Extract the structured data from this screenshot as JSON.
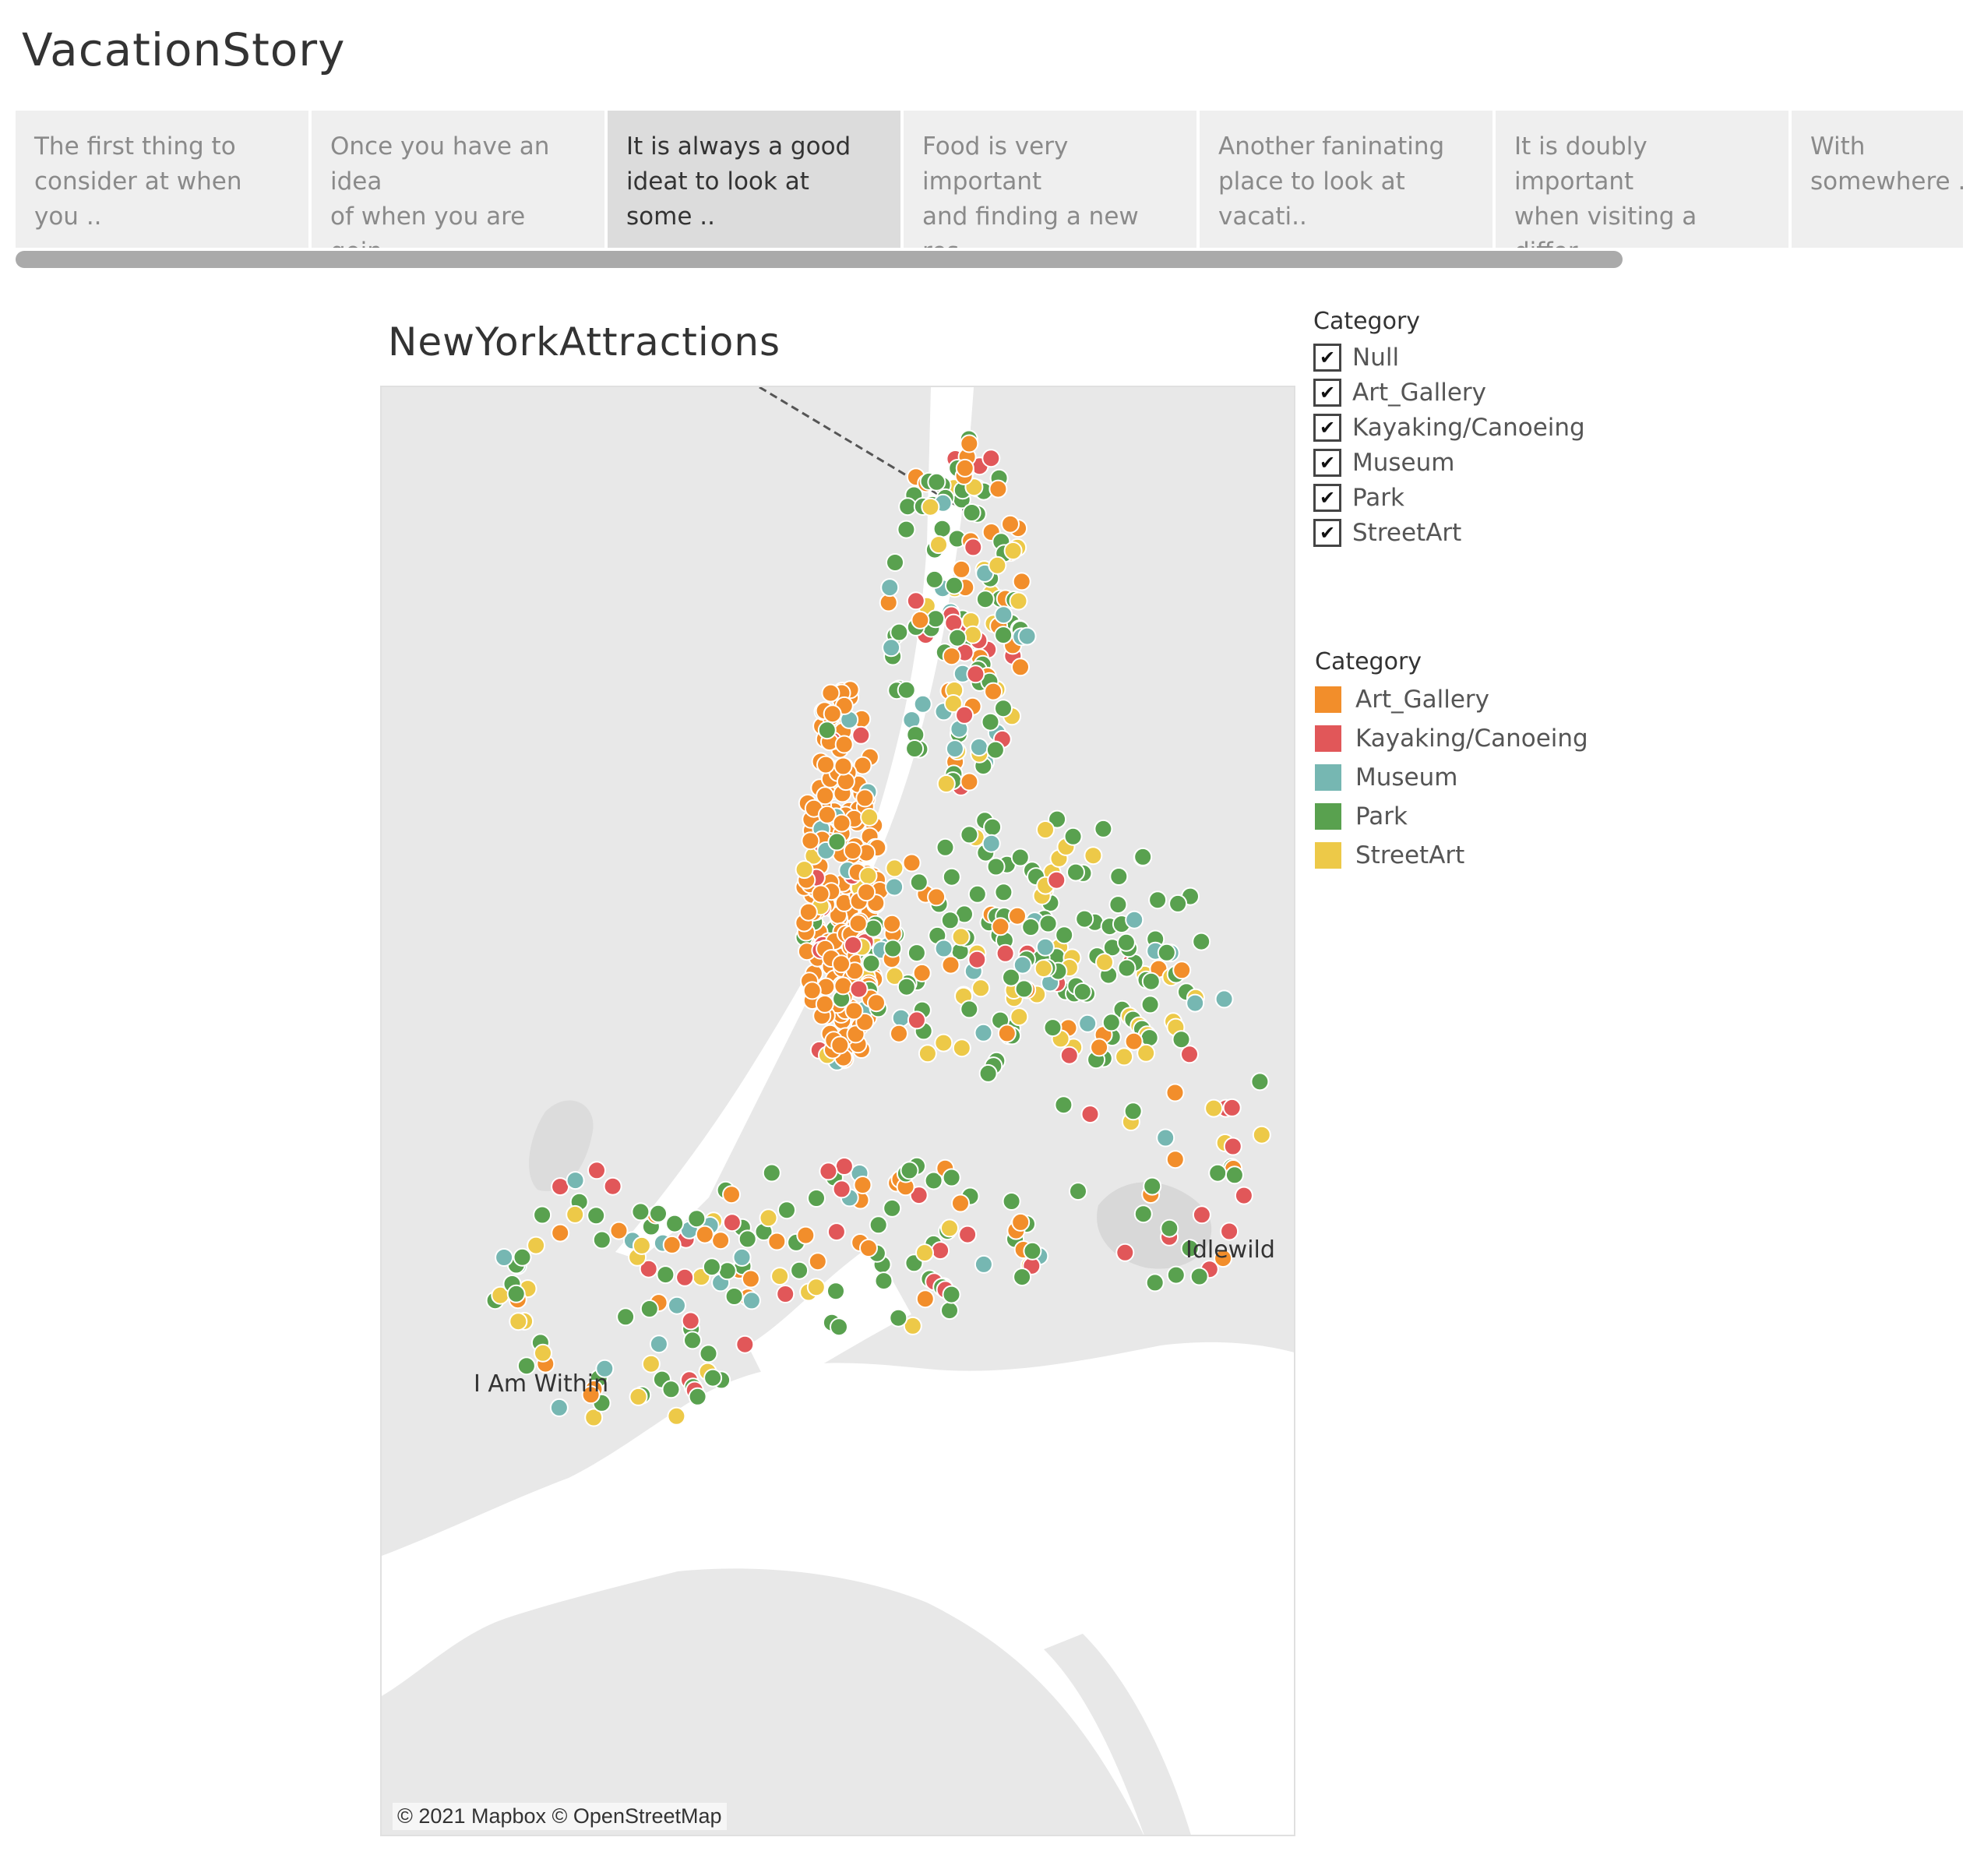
{
  "story": {
    "title": "VacationStory"
  },
  "tabs": [
    {
      "text": "The first thing to\nconsider at when you ..",
      "active": false
    },
    {
      "text": "Once you have an idea\nof when you are goin..",
      "active": false
    },
    {
      "text": "It is always a good\nideat to look at some ..",
      "active": true
    },
    {
      "text": "Food is very important\nand finding a new res..",
      "active": false
    },
    {
      "text": "Another faninating\nplace to look at vacati..",
      "active": false
    },
    {
      "text": "It is doubly important\nwhen visiting a differ..",
      "active": false
    },
    {
      "text": "With\nsomewhere ..",
      "active": false
    }
  ],
  "map": {
    "title": "NewYorkAttractions",
    "labels": {
      "idlewild": "Idlewild",
      "i_am_within": "I Am Within"
    },
    "attribution": "© 2021 Mapbox © OpenStreetMap"
  },
  "filter": {
    "title": "Category",
    "items": [
      {
        "label": "Null",
        "checked": true
      },
      {
        "label": "Art_Gallery",
        "checked": true
      },
      {
        "label": "Kayaking/Canoeing",
        "checked": true
      },
      {
        "label": "Museum",
        "checked": true
      },
      {
        "label": "Park",
        "checked": true
      },
      {
        "label": "StreetArt",
        "checked": true
      }
    ],
    "check_glyph": "✔"
  },
  "legend": {
    "title": "Category",
    "items": [
      {
        "label": "Art_Gallery",
        "color": "#f28e2b"
      },
      {
        "label": "Kayaking/Canoeing",
        "color": "#e15759"
      },
      {
        "label": "Museum",
        "color": "#76b7b2"
      },
      {
        "label": "Park",
        "color": "#59a14f"
      },
      {
        "label": "StreetArt",
        "color": "#edc948"
      }
    ]
  },
  "colors": {
    "map_land": "#e8e8e8",
    "map_water": "#ffffff",
    "tab_active": "#dcdcdc",
    "tab_inactive": "#efefef"
  }
}
